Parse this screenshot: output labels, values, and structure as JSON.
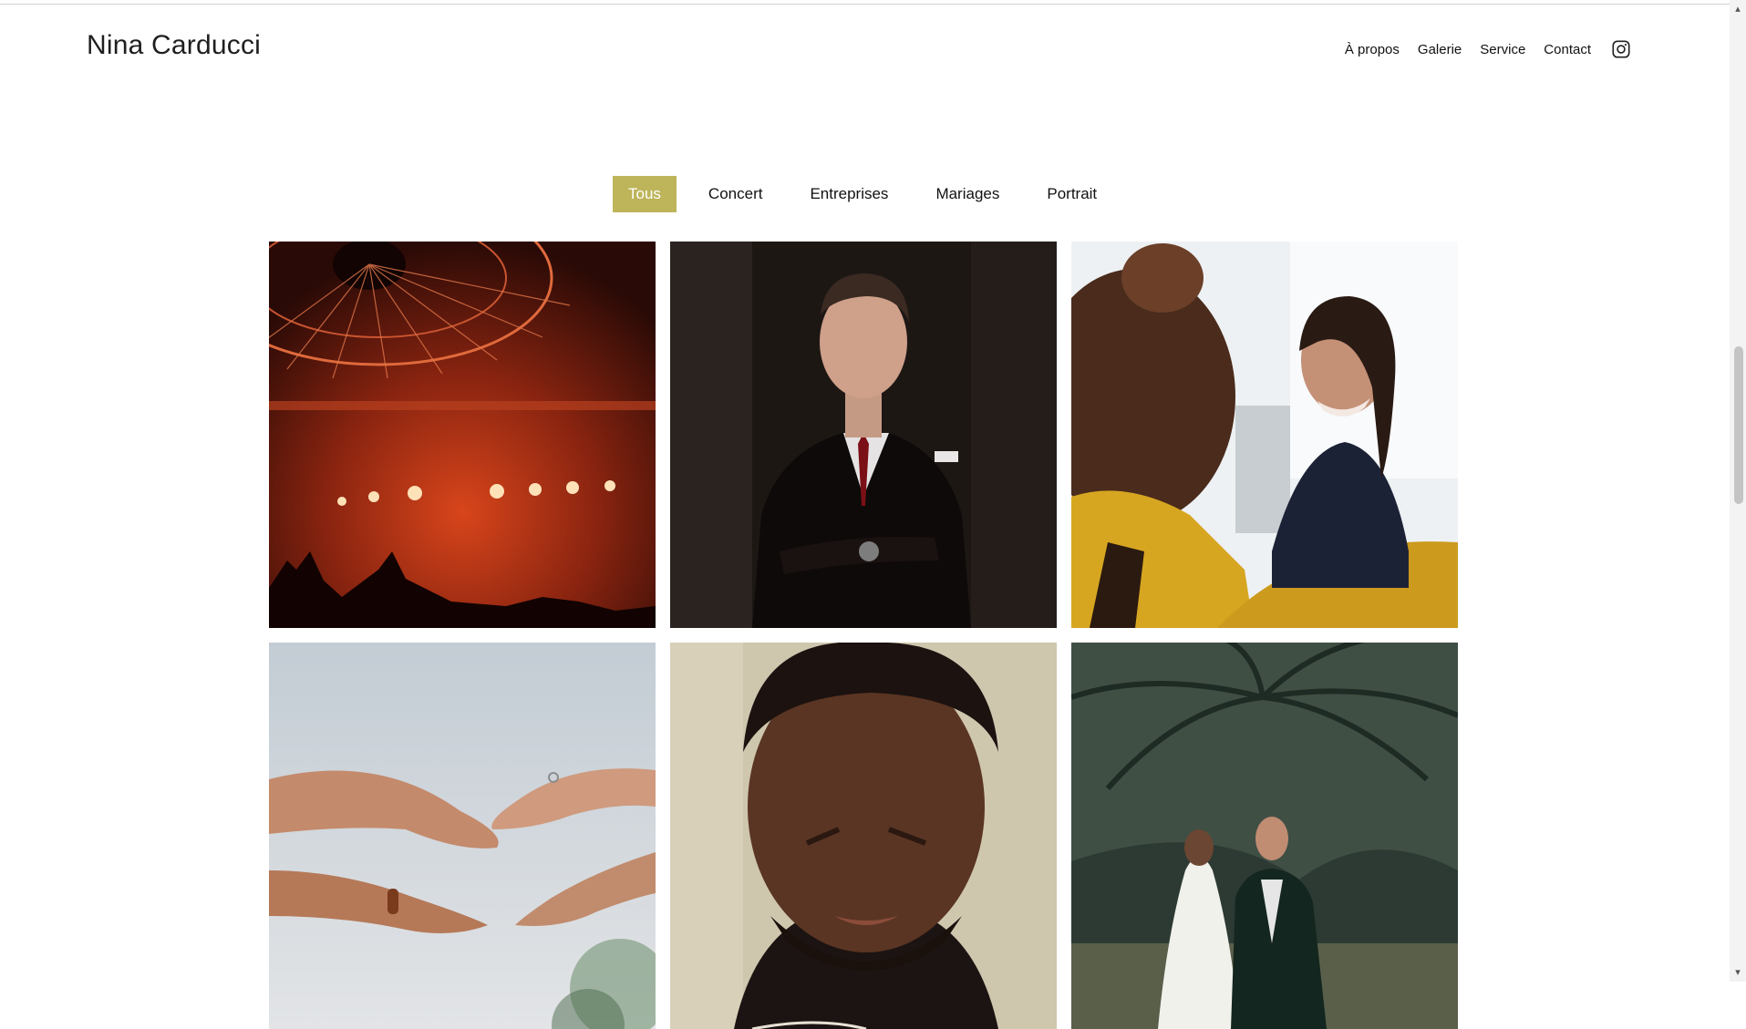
{
  "header": {
    "brand": "Nina Carducci",
    "nav": [
      {
        "label": "À propos"
      },
      {
        "label": "Galerie"
      },
      {
        "label": "Service"
      },
      {
        "label": "Contact"
      }
    ],
    "instagram_icon": "instagram-icon"
  },
  "filters": {
    "items": [
      "Tous",
      "Concert",
      "Entreprises",
      "Mariages",
      "Portrait"
    ],
    "active": "Tous"
  },
  "gallery": {
    "tiles": [
      {
        "subject": "concert-stage",
        "category": "Concert"
      },
      {
        "subject": "man-in-suit",
        "category": "Entreprises"
      },
      {
        "subject": "office-meeting",
        "category": "Entreprises"
      },
      {
        "subject": "hands-with-ring",
        "category": "Mariages"
      },
      {
        "subject": "man-portrait",
        "category": "Portrait"
      },
      {
        "subject": "wedding-couple",
        "category": "Mariages"
      }
    ]
  },
  "colors": {
    "accent": "#beb45a",
    "text": "#111111",
    "background": "#ffffff"
  }
}
